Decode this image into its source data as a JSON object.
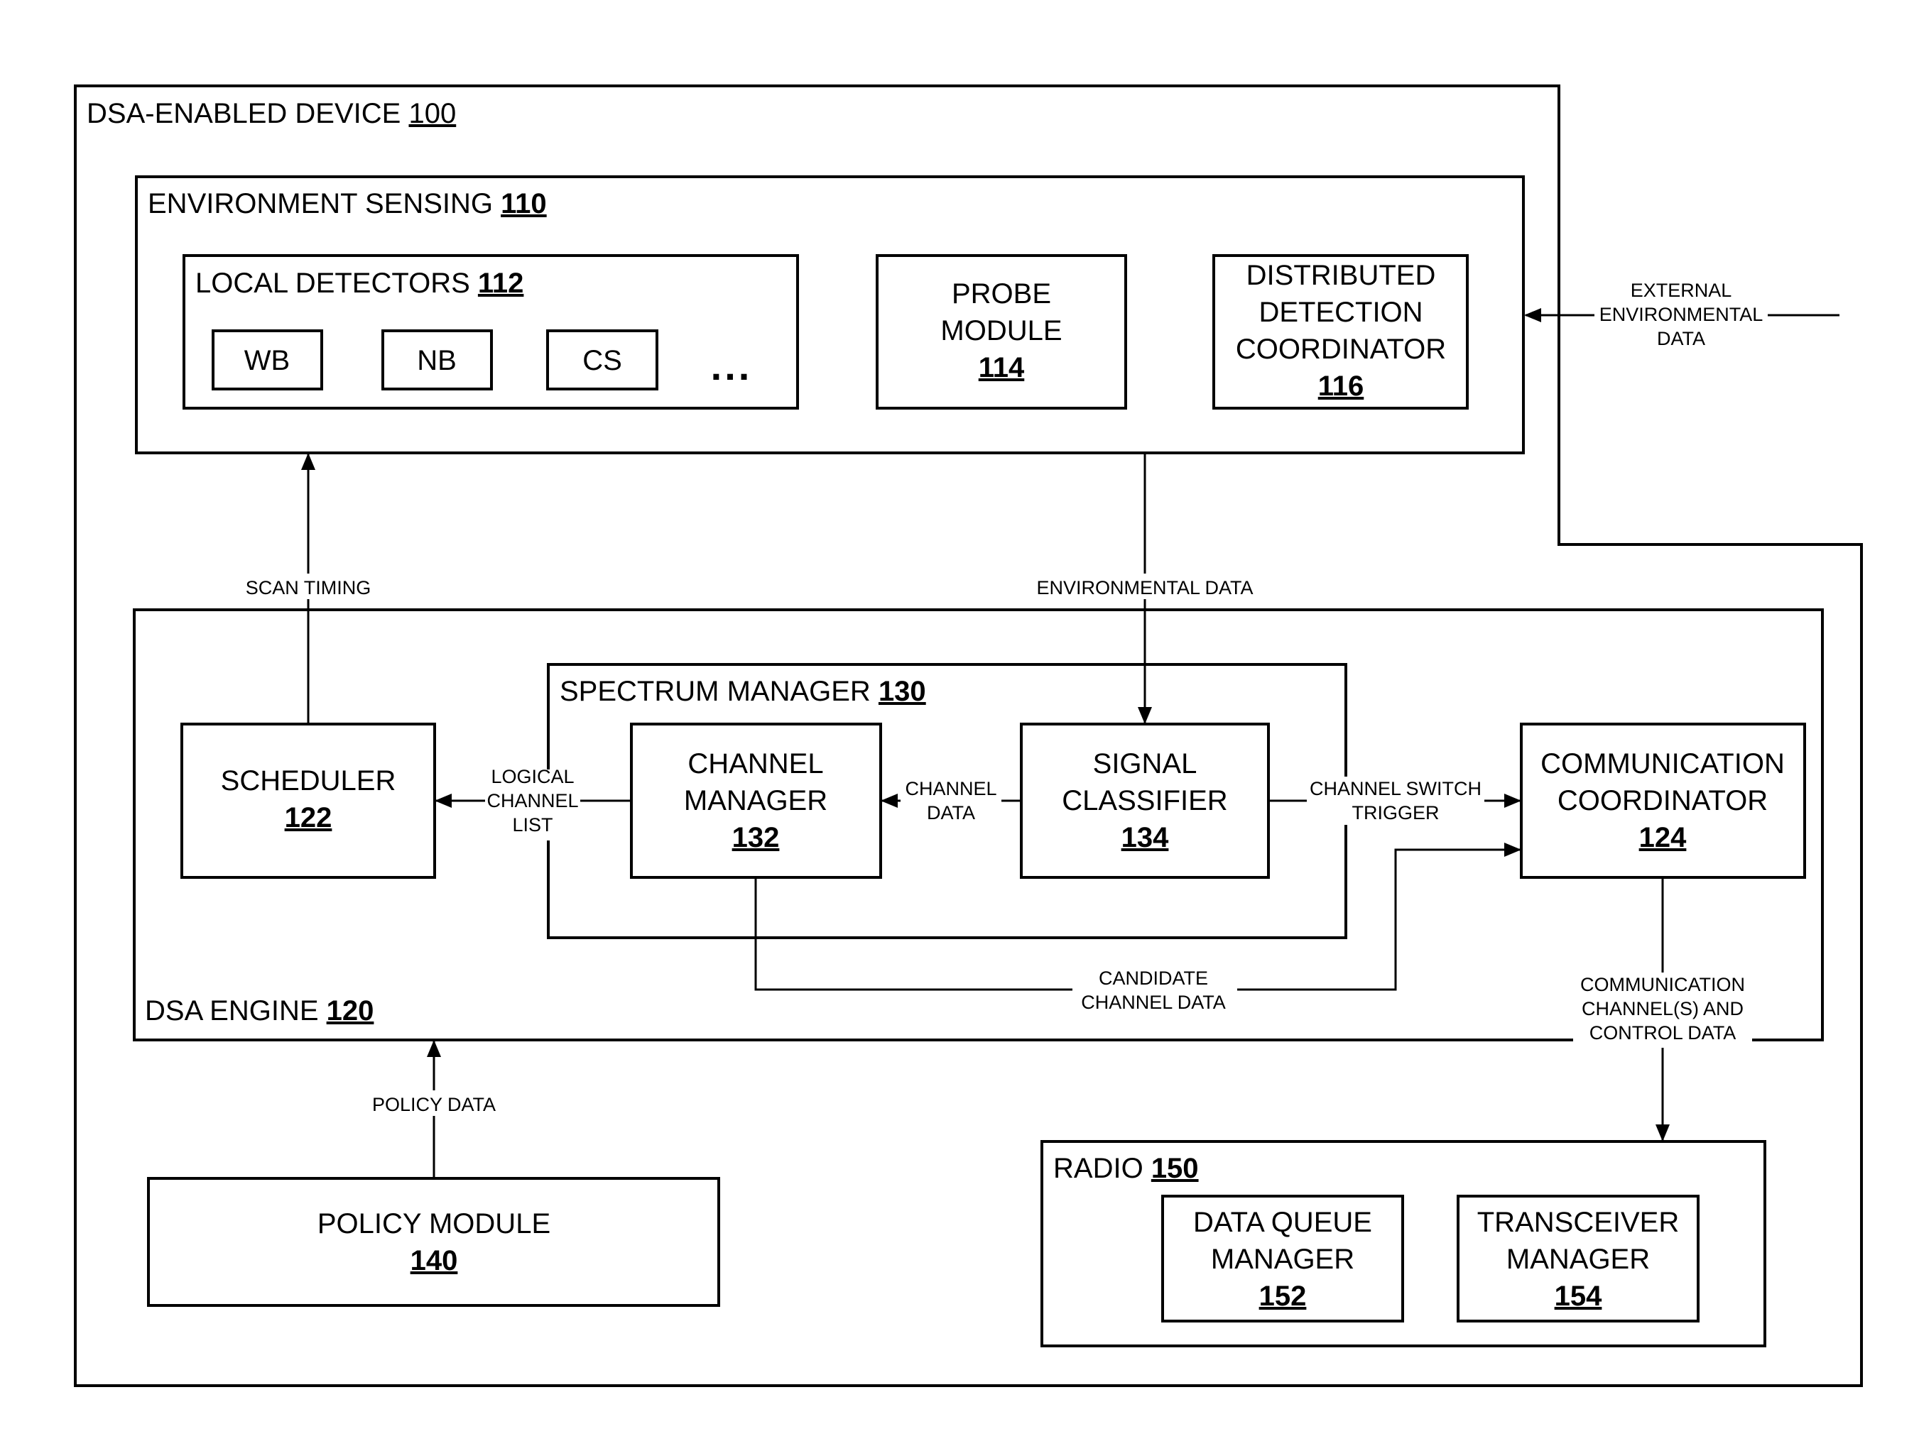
{
  "device": {
    "title": "DSA-ENABLED DEVICE",
    "number": "100"
  },
  "environment_sensing": {
    "title": "ENVIRONMENT SENSING",
    "number": "110",
    "local_detectors": {
      "title": "LOCAL DETECTORS",
      "number": "112",
      "detectors": [
        "WB",
        "NB",
        "CS"
      ],
      "ellipsis": "..."
    },
    "probe_module": {
      "lines": [
        "PROBE",
        "MODULE"
      ],
      "number": "114"
    },
    "distributed_detection_coordinator": {
      "lines": [
        "DISTRIBUTED",
        "DETECTION",
        "COORDINATOR"
      ],
      "number": "116"
    }
  },
  "dsa_engine": {
    "title": "DSA ENGINE",
    "number": "120",
    "scheduler": {
      "lines": [
        "SCHEDULER"
      ],
      "number": "122"
    },
    "communication_coordinator": {
      "lines": [
        "COMMUNICATION",
        "COORDINATOR"
      ],
      "number": "124"
    },
    "spectrum_manager": {
      "title": "SPECTRUM MANAGER",
      "number": "130",
      "channel_manager": {
        "lines": [
          "CHANNEL",
          "MANAGER"
        ],
        "number": "132"
      },
      "signal_classifier": {
        "lines": [
          "SIGNAL",
          "CLASSIFIER"
        ],
        "number": "134"
      }
    }
  },
  "policy_module": {
    "lines": [
      "POLICY MODULE"
    ],
    "number": "140"
  },
  "radio": {
    "title": "RADIO",
    "number": "150",
    "data_queue_manager": {
      "lines": [
        "DATA QUEUE",
        "MANAGER"
      ],
      "number": "152"
    },
    "transceiver_manager": {
      "lines": [
        "TRANSCEIVER",
        "MANAGER"
      ],
      "number": "154"
    }
  },
  "connections": {
    "external_environmental_data": [
      "EXTERNAL",
      "ENVIRONMENTAL",
      "DATA"
    ],
    "scan_timing": [
      "SCAN TIMING"
    ],
    "environmental_data": [
      "ENVIRONMENTAL DATA"
    ],
    "logical_channel_list": [
      "LOGICAL",
      "CHANNEL",
      "LIST"
    ],
    "channel_data": [
      "CHANNEL",
      "DATA"
    ],
    "channel_switch_trigger": [
      "CHANNEL SWITCH",
      "TRIGGER"
    ],
    "candidate_channel_data": [
      "CANDIDATE",
      "CHANNEL DATA"
    ],
    "communication_channels_control": [
      "COMMUNICATION",
      "CHANNEL(S) AND",
      "CONTROL DATA"
    ],
    "policy_data": [
      "POLICY DATA"
    ]
  }
}
